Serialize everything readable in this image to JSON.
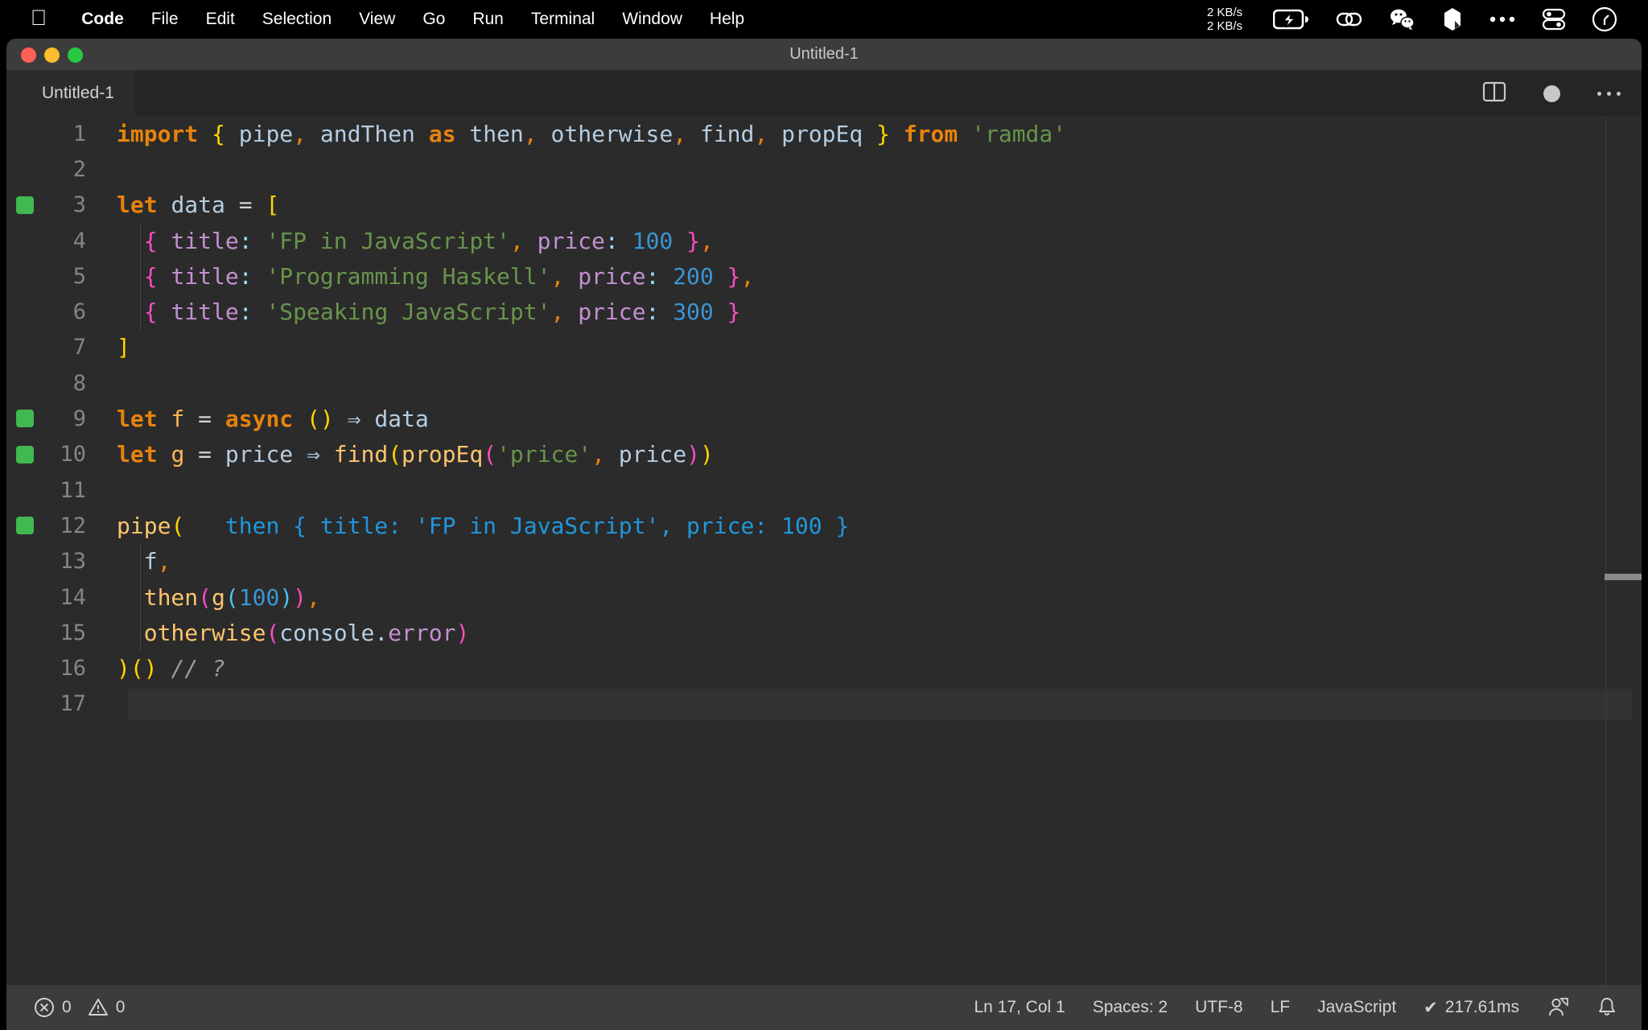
{
  "menubar": {
    "apple_logo": "apple-logo",
    "items": [
      {
        "label": "Code",
        "bold": true
      },
      {
        "label": "File",
        "bold": false
      },
      {
        "label": "Edit",
        "bold": false
      },
      {
        "label": "Selection",
        "bold": false
      },
      {
        "label": "View",
        "bold": false
      },
      {
        "label": "Go",
        "bold": false
      },
      {
        "label": "Run",
        "bold": false
      },
      {
        "label": "Terminal",
        "bold": false
      },
      {
        "label": "Window",
        "bold": false
      },
      {
        "label": "Help",
        "bold": false
      }
    ],
    "network_up": "2 KB/s",
    "network_down": "2 KB/s",
    "status_icons": [
      "battery-charging-icon",
      "link-icon",
      "wechat-icon",
      "app-icon",
      "ellipsis-icon",
      "control-center-icon",
      "clock-icon"
    ]
  },
  "window": {
    "title": "Untitled-1",
    "traffic_lights": [
      "close",
      "minimize",
      "zoom"
    ]
  },
  "tabbar": {
    "tab_label": "Untitled-1",
    "actions": [
      "split-editor-icon",
      "unsaved-dot-icon",
      "more-actions-icon"
    ]
  },
  "editor": {
    "lines": [
      {
        "n": "1",
        "marker": false,
        "indent_guide": false,
        "current": false,
        "tokens": [
          {
            "t": "import",
            "c": "k"
          },
          {
            "t": " ",
            "c": "op"
          },
          {
            "t": "{",
            "c": "br-y"
          },
          {
            "t": " ",
            "c": "op"
          },
          {
            "t": "pipe",
            "c": "id"
          },
          {
            "t": ",",
            "c": "comma"
          },
          {
            "t": " ",
            "c": "op"
          },
          {
            "t": "andThen",
            "c": "id"
          },
          {
            "t": " ",
            "c": "op"
          },
          {
            "t": "as",
            "c": "k"
          },
          {
            "t": " ",
            "c": "op"
          },
          {
            "t": "then",
            "c": "id"
          },
          {
            "t": ",",
            "c": "comma"
          },
          {
            "t": " ",
            "c": "op"
          },
          {
            "t": "otherwise",
            "c": "id"
          },
          {
            "t": ",",
            "c": "comma"
          },
          {
            "t": " ",
            "c": "op"
          },
          {
            "t": "find",
            "c": "id"
          },
          {
            "t": ",",
            "c": "comma"
          },
          {
            "t": " ",
            "c": "op"
          },
          {
            "t": "propEq",
            "c": "id"
          },
          {
            "t": " ",
            "c": "op"
          },
          {
            "t": "}",
            "c": "br-y"
          },
          {
            "t": " ",
            "c": "op"
          },
          {
            "t": "from",
            "c": "k"
          },
          {
            "t": " ",
            "c": "op"
          },
          {
            "t": "'ramda'",
            "c": "str"
          }
        ]
      },
      {
        "n": "2",
        "marker": false,
        "indent_guide": false,
        "current": false,
        "tokens": []
      },
      {
        "n": "3",
        "marker": true,
        "indent_guide": false,
        "current": false,
        "tokens": [
          {
            "t": "let",
            "c": "k"
          },
          {
            "t": " ",
            "c": "op"
          },
          {
            "t": "data",
            "c": "id"
          },
          {
            "t": " ",
            "c": "op"
          },
          {
            "t": "=",
            "c": "op"
          },
          {
            "t": " ",
            "c": "op"
          },
          {
            "t": "[",
            "c": "br-y"
          }
        ]
      },
      {
        "n": "4",
        "marker": false,
        "indent_guide": true,
        "current": false,
        "tokens": [
          {
            "t": "  ",
            "c": "op"
          },
          {
            "t": "{",
            "c": "br-m"
          },
          {
            "t": " ",
            "c": "op"
          },
          {
            "t": "title",
            "c": "prop"
          },
          {
            "t": ":",
            "c": "colon"
          },
          {
            "t": " ",
            "c": "op"
          },
          {
            "t": "'FP in JavaScript'",
            "c": "str"
          },
          {
            "t": ",",
            "c": "comma"
          },
          {
            "t": " ",
            "c": "op"
          },
          {
            "t": "price",
            "c": "prop"
          },
          {
            "t": ":",
            "c": "colon"
          },
          {
            "t": " ",
            "c": "op"
          },
          {
            "t": "100",
            "c": "num"
          },
          {
            "t": " ",
            "c": "op"
          },
          {
            "t": "}",
            "c": "br-m"
          },
          {
            "t": ",",
            "c": "comma"
          }
        ]
      },
      {
        "n": "5",
        "marker": false,
        "indent_guide": true,
        "current": false,
        "tokens": [
          {
            "t": "  ",
            "c": "op"
          },
          {
            "t": "{",
            "c": "br-m"
          },
          {
            "t": " ",
            "c": "op"
          },
          {
            "t": "title",
            "c": "prop"
          },
          {
            "t": ":",
            "c": "colon"
          },
          {
            "t": " ",
            "c": "op"
          },
          {
            "t": "'Programming Haskell'",
            "c": "str"
          },
          {
            "t": ",",
            "c": "comma"
          },
          {
            "t": " ",
            "c": "op"
          },
          {
            "t": "price",
            "c": "prop"
          },
          {
            "t": ":",
            "c": "colon"
          },
          {
            "t": " ",
            "c": "op"
          },
          {
            "t": "200",
            "c": "num"
          },
          {
            "t": " ",
            "c": "op"
          },
          {
            "t": "}",
            "c": "br-m"
          },
          {
            "t": ",",
            "c": "comma"
          }
        ]
      },
      {
        "n": "6",
        "marker": false,
        "indent_guide": true,
        "current": false,
        "tokens": [
          {
            "t": "  ",
            "c": "op"
          },
          {
            "t": "{",
            "c": "br-m"
          },
          {
            "t": " ",
            "c": "op"
          },
          {
            "t": "title",
            "c": "prop"
          },
          {
            "t": ":",
            "c": "colon"
          },
          {
            "t": " ",
            "c": "op"
          },
          {
            "t": "'Speaking JavaScript'",
            "c": "str"
          },
          {
            "t": ",",
            "c": "comma"
          },
          {
            "t": " ",
            "c": "op"
          },
          {
            "t": "price",
            "c": "prop"
          },
          {
            "t": ":",
            "c": "colon"
          },
          {
            "t": " ",
            "c": "op"
          },
          {
            "t": "300",
            "c": "num"
          },
          {
            "t": " ",
            "c": "op"
          },
          {
            "t": "}",
            "c": "br-m"
          }
        ]
      },
      {
        "n": "7",
        "marker": false,
        "indent_guide": false,
        "current": false,
        "tokens": [
          {
            "t": "]",
            "c": "br-y"
          }
        ]
      },
      {
        "n": "8",
        "marker": false,
        "indent_guide": false,
        "current": false,
        "tokens": []
      },
      {
        "n": "9",
        "marker": true,
        "indent_guide": false,
        "current": false,
        "tokens": [
          {
            "t": "let",
            "c": "k"
          },
          {
            "t": " ",
            "c": "op"
          },
          {
            "t": "f",
            "c": "var"
          },
          {
            "t": " ",
            "c": "op"
          },
          {
            "t": "=",
            "c": "op"
          },
          {
            "t": " ",
            "c": "op"
          },
          {
            "t": "async",
            "c": "k"
          },
          {
            "t": " ",
            "c": "op"
          },
          {
            "t": "()",
            "c": "br-y"
          },
          {
            "t": " ",
            "c": "op"
          },
          {
            "t": "⇒",
            "c": "arrow"
          },
          {
            "t": " ",
            "c": "op"
          },
          {
            "t": "data",
            "c": "id"
          }
        ]
      },
      {
        "n": "10",
        "marker": true,
        "indent_guide": false,
        "current": false,
        "tokens": [
          {
            "t": "let",
            "c": "k"
          },
          {
            "t": " ",
            "c": "op"
          },
          {
            "t": "g",
            "c": "var"
          },
          {
            "t": " ",
            "c": "op"
          },
          {
            "t": "=",
            "c": "op"
          },
          {
            "t": " ",
            "c": "op"
          },
          {
            "t": "price",
            "c": "id"
          },
          {
            "t": " ",
            "c": "op"
          },
          {
            "t": "⇒",
            "c": "arrow"
          },
          {
            "t": " ",
            "c": "op"
          },
          {
            "t": "find",
            "c": "fn"
          },
          {
            "t": "(",
            "c": "br-y"
          },
          {
            "t": "propEq",
            "c": "fn"
          },
          {
            "t": "(",
            "c": "br-m"
          },
          {
            "t": "'price'",
            "c": "str"
          },
          {
            "t": ",",
            "c": "comma"
          },
          {
            "t": " ",
            "c": "op"
          },
          {
            "t": "price",
            "c": "id"
          },
          {
            "t": ")",
            "c": "br-m"
          },
          {
            "t": ")",
            "c": "br-y"
          }
        ]
      },
      {
        "n": "11",
        "marker": false,
        "indent_guide": false,
        "current": false,
        "tokens": []
      },
      {
        "n": "12",
        "marker": true,
        "indent_guide": false,
        "current": false,
        "tokens": [
          {
            "t": "pipe",
            "c": "fn"
          },
          {
            "t": "(",
            "c": "br-y"
          },
          {
            "t": "   then { title: 'FP in JavaScript', price: 100 }",
            "c": "hint"
          }
        ]
      },
      {
        "n": "13",
        "marker": false,
        "indent_guide": true,
        "current": false,
        "tokens": [
          {
            "t": "  ",
            "c": "op"
          },
          {
            "t": "f",
            "c": "id"
          },
          {
            "t": ",",
            "c": "comma"
          }
        ]
      },
      {
        "n": "14",
        "marker": false,
        "indent_guide": true,
        "current": false,
        "tokens": [
          {
            "t": "  ",
            "c": "op"
          },
          {
            "t": "then",
            "c": "fn"
          },
          {
            "t": "(",
            "c": "br-m"
          },
          {
            "t": "g",
            "c": "fn"
          },
          {
            "t": "(",
            "c": "br-c"
          },
          {
            "t": "100",
            "c": "num"
          },
          {
            "t": ")",
            "c": "br-c"
          },
          {
            "t": ")",
            "c": "br-m"
          },
          {
            "t": ",",
            "c": "comma"
          }
        ]
      },
      {
        "n": "15",
        "marker": false,
        "indent_guide": true,
        "current": false,
        "tokens": [
          {
            "t": "  ",
            "c": "op"
          },
          {
            "t": "otherwise",
            "c": "fn"
          },
          {
            "t": "(",
            "c": "br-m"
          },
          {
            "t": "console",
            "c": "id"
          },
          {
            "t": ".",
            "c": "id"
          },
          {
            "t": "error",
            "c": "prop"
          },
          {
            "t": ")",
            "c": "br-m"
          }
        ]
      },
      {
        "n": "16",
        "marker": false,
        "indent_guide": false,
        "current": false,
        "tokens": [
          {
            "t": ")()",
            "c": "br-y"
          },
          {
            "t": " ",
            "c": "op"
          },
          {
            "t": "// ?",
            "c": "cmt"
          }
        ]
      },
      {
        "n": "17",
        "marker": false,
        "indent_guide": false,
        "current": true,
        "tokens": []
      }
    ]
  },
  "statusbar": {
    "errors": "0",
    "warnings": "0",
    "cursor": "Ln 17, Col 1",
    "indentation": "Spaces: 2",
    "encoding": "UTF-8",
    "eol": "LF",
    "language": "JavaScript",
    "timing": "217.61ms",
    "timing_check": "✔",
    "right_icons": [
      "account-icon",
      "notifications-bell-icon"
    ]
  },
  "colors": {
    "menubar_bg": "#000000",
    "titlebar_bg": "#3c3c3c",
    "editor_bg": "#2b2b2b",
    "statusbar_bg": "#3c3c3c",
    "marker_green": "#3fb950",
    "hint_blue": "#2196dc"
  }
}
